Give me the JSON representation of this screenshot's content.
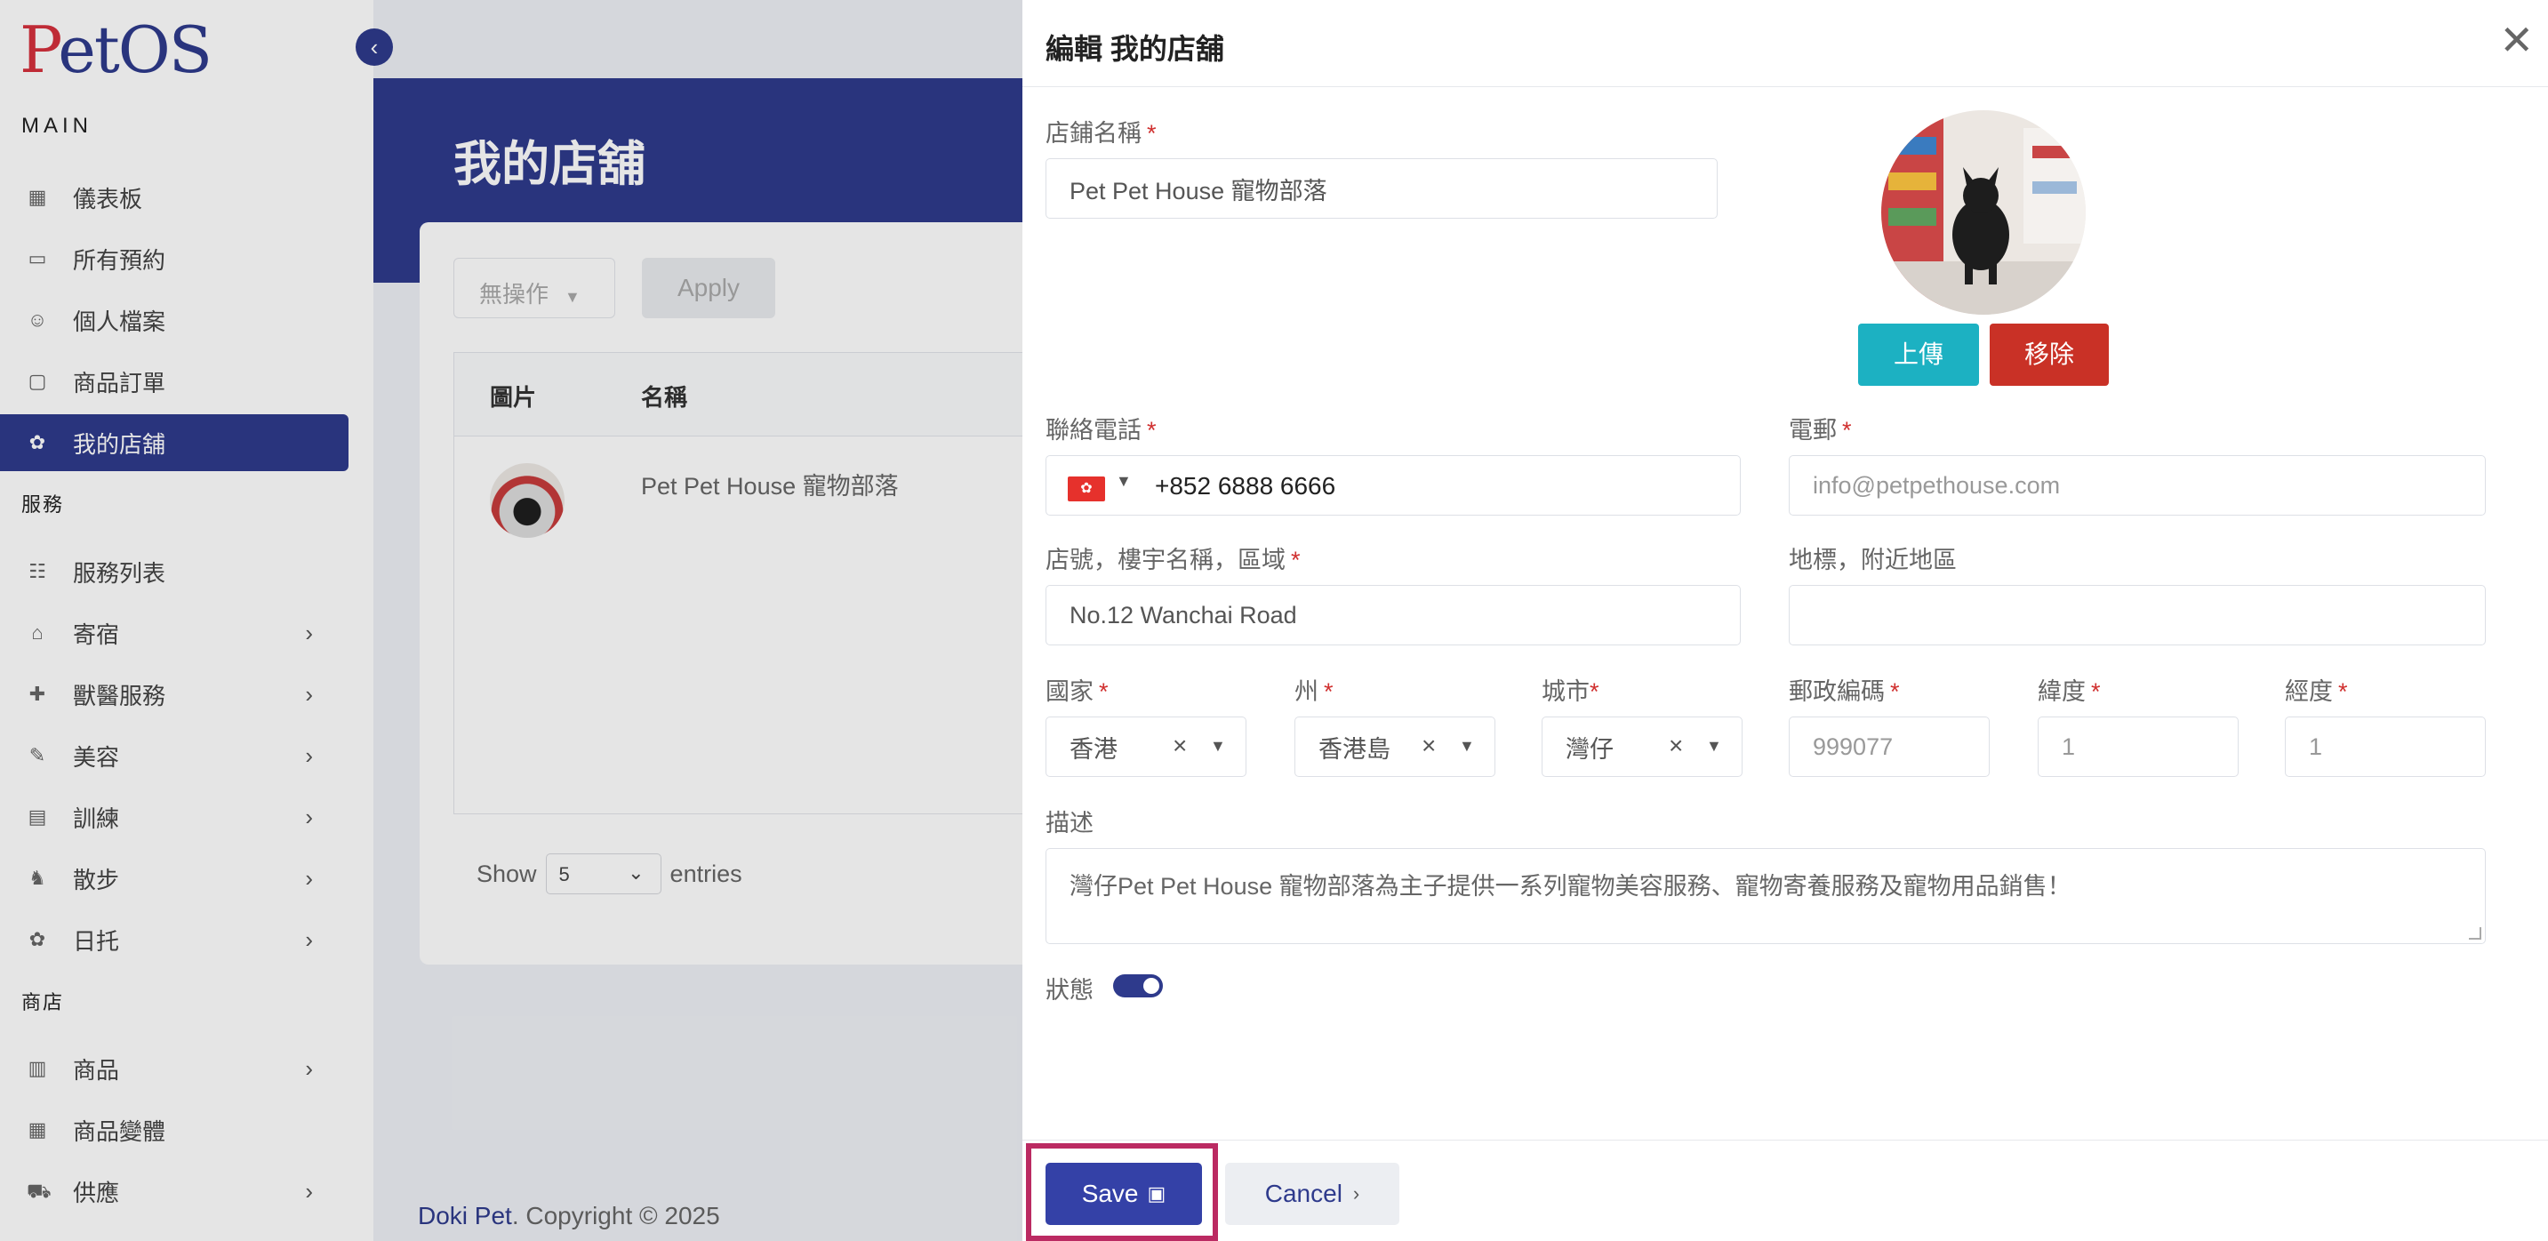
{
  "sidebar": {
    "logo": "PetOS",
    "section_main": "MAIN",
    "section_services": "服務",
    "section_shop": "商店",
    "items": [
      {
        "label": "儀表板",
        "icon": "grid-icon"
      },
      {
        "label": "所有預約",
        "icon": "calendar-icon"
      },
      {
        "label": "個人檔案",
        "icon": "user-icon"
      },
      {
        "label": "商品訂單",
        "icon": "bag-icon"
      },
      {
        "label": "我的店舖",
        "icon": "store-icon"
      },
      {
        "label": "服務列表",
        "icon": "list-icon"
      },
      {
        "label": "寄宿",
        "icon": "house-icon"
      },
      {
        "label": "獸醫服務",
        "icon": "vet-icon"
      },
      {
        "label": "美容",
        "icon": "brush-icon"
      },
      {
        "label": "訓練",
        "icon": "training-icon"
      },
      {
        "label": "散步",
        "icon": "walk-icon"
      },
      {
        "label": "日托",
        "icon": "daycare-icon"
      },
      {
        "label": "商品",
        "icon": "shop-icon"
      },
      {
        "label": "商品變體",
        "icon": "variant-icon"
      },
      {
        "label": "供應",
        "icon": "truck-icon"
      }
    ]
  },
  "main": {
    "page_title": "我的店舖",
    "bulk_action": "無操作",
    "apply_label": "Apply",
    "table": {
      "columns": [
        "圖片",
        "名稱"
      ],
      "rows": [
        {
          "name": "Pet Pet House 寵物部落"
        }
      ]
    },
    "show_label": "Show",
    "show_value": "5",
    "entries_label": "entries",
    "footer_brand": "Doki Pet",
    "footer_text": ". Copyright © 2025"
  },
  "drawer": {
    "title": "編輯 我的店舖",
    "fields": {
      "shop_name": {
        "label": "店鋪名稱",
        "value": "Pet Pet House 寵物部落"
      },
      "phone": {
        "label": "聯絡電話",
        "value": "+852 6888 6666"
      },
      "email": {
        "label": "電郵",
        "value": "info@petpethouse.com"
      },
      "address": {
        "label": "店號，樓宇名稱，區域",
        "value": "No.12 Wanchai Road"
      },
      "landmark": {
        "label": "地標，附近地區",
        "value": ""
      },
      "country": {
        "label": "國家",
        "value": "香港"
      },
      "state": {
        "label": "州",
        "value": "香港島"
      },
      "city": {
        "label": "城市",
        "value": "灣仔"
      },
      "postal": {
        "label": "郵政編碼",
        "value": "999077"
      },
      "latitude": {
        "label": "緯度",
        "value": "1"
      },
      "longitude": {
        "label": "經度",
        "value": "1"
      },
      "description": {
        "label": "描述",
        "value": "灣仔Pet Pet House 寵物部落為主子提供一系列寵物美容服務、寵物寄養服務及寵物用品銷售！"
      },
      "status": {
        "label": "狀態",
        "enabled": true
      }
    },
    "required_mark": "*",
    "upload_label": "上傳",
    "remove_label": "移除",
    "save_label": "Save",
    "cancel_label": "Cancel"
  },
  "colors": {
    "primary": "#2e3a8c",
    "upload": "#1cb1c2",
    "remove": "#c93126",
    "highlight": "#bb2a62"
  }
}
